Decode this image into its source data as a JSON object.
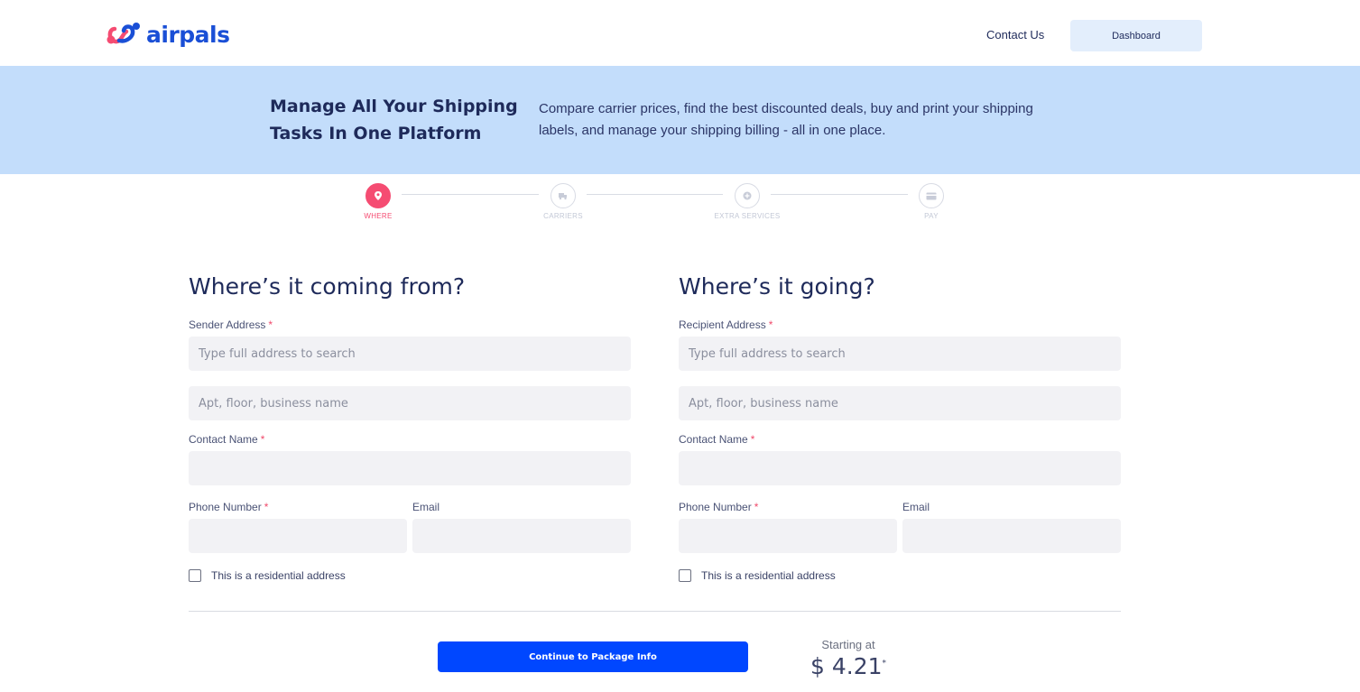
{
  "header": {
    "logo_text": "airpals",
    "contact_label": "Contact Us",
    "dashboard_label": "Dashboard"
  },
  "banner": {
    "title": "Manage All Your Shipping Tasks In One Platform",
    "description": "Compare carrier prices, find the best discounted deals, buy and print your shipping labels, and manage your shipping billing - all in one place."
  },
  "stepper": {
    "steps": [
      {
        "label": "WHERE",
        "icon": "location-pin-icon",
        "active": true
      },
      {
        "label": "CARRIERS",
        "icon": "truck-icon",
        "active": false
      },
      {
        "label": "EXTRA SERVICES",
        "icon": "plus-circle-icon",
        "active": false
      },
      {
        "label": "PAY",
        "icon": "credit-card-icon",
        "active": false
      }
    ]
  },
  "sender": {
    "heading": "Where’s it coming from?",
    "address_label": "Sender Address",
    "address_placeholder": "Type full address to search",
    "apt_placeholder": "Apt, floor, business name",
    "contact_label": "Contact Name",
    "phone_label": "Phone Number",
    "email_label": "Email",
    "residential_label": "This is a residential address"
  },
  "recipient": {
    "heading": "Where’s it going?",
    "address_label": "Recipient Address",
    "address_placeholder": "Type full address to search",
    "apt_placeholder": "Apt, floor, business name",
    "contact_label": "Contact Name",
    "phone_label": "Phone Number",
    "email_label": "Email",
    "residential_label": "This is a residential address"
  },
  "required_marker": "*",
  "footer": {
    "continue_label": "Continue to Package Info",
    "starting_at_label": "Starting at",
    "price": "$ 4.21",
    "price_marker": "*"
  },
  "colors": {
    "brand_blue": "#1a4fd6",
    "primary_button": "#0047ff",
    "accent_pink": "#f54c72",
    "banner_bg": "#c3ddfb",
    "input_bg": "#f2f2f5"
  }
}
